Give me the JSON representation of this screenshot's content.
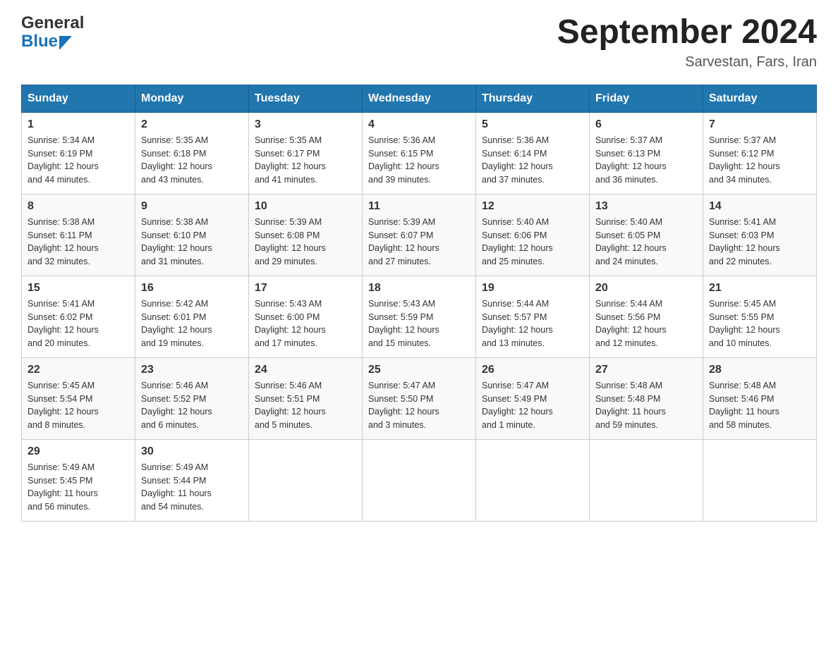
{
  "header": {
    "logo_general": "General",
    "logo_blue": "Blue",
    "month_title": "September 2024",
    "location": "Sarvestan, Fars, Iran"
  },
  "days_of_week": [
    "Sunday",
    "Monday",
    "Tuesday",
    "Wednesday",
    "Thursday",
    "Friday",
    "Saturday"
  ],
  "weeks": [
    [
      {
        "date": "1",
        "sunrise": "5:34 AM",
        "sunset": "6:19 PM",
        "daylight": "12 hours and 44 minutes."
      },
      {
        "date": "2",
        "sunrise": "5:35 AM",
        "sunset": "6:18 PM",
        "daylight": "12 hours and 43 minutes."
      },
      {
        "date": "3",
        "sunrise": "5:35 AM",
        "sunset": "6:17 PM",
        "daylight": "12 hours and 41 minutes."
      },
      {
        "date": "4",
        "sunrise": "5:36 AM",
        "sunset": "6:15 PM",
        "daylight": "12 hours and 39 minutes."
      },
      {
        "date": "5",
        "sunrise": "5:36 AM",
        "sunset": "6:14 PM",
        "daylight": "12 hours and 37 minutes."
      },
      {
        "date": "6",
        "sunrise": "5:37 AM",
        "sunset": "6:13 PM",
        "daylight": "12 hours and 36 minutes."
      },
      {
        "date": "7",
        "sunrise": "5:37 AM",
        "sunset": "6:12 PM",
        "daylight": "12 hours and 34 minutes."
      }
    ],
    [
      {
        "date": "8",
        "sunrise": "5:38 AM",
        "sunset": "6:11 PM",
        "daylight": "12 hours and 32 minutes."
      },
      {
        "date": "9",
        "sunrise": "5:38 AM",
        "sunset": "6:10 PM",
        "daylight": "12 hours and 31 minutes."
      },
      {
        "date": "10",
        "sunrise": "5:39 AM",
        "sunset": "6:08 PM",
        "daylight": "12 hours and 29 minutes."
      },
      {
        "date": "11",
        "sunrise": "5:39 AM",
        "sunset": "6:07 PM",
        "daylight": "12 hours and 27 minutes."
      },
      {
        "date": "12",
        "sunrise": "5:40 AM",
        "sunset": "6:06 PM",
        "daylight": "12 hours and 25 minutes."
      },
      {
        "date": "13",
        "sunrise": "5:40 AM",
        "sunset": "6:05 PM",
        "daylight": "12 hours and 24 minutes."
      },
      {
        "date": "14",
        "sunrise": "5:41 AM",
        "sunset": "6:03 PM",
        "daylight": "12 hours and 22 minutes."
      }
    ],
    [
      {
        "date": "15",
        "sunrise": "5:41 AM",
        "sunset": "6:02 PM",
        "daylight": "12 hours and 20 minutes."
      },
      {
        "date": "16",
        "sunrise": "5:42 AM",
        "sunset": "6:01 PM",
        "daylight": "12 hours and 19 minutes."
      },
      {
        "date": "17",
        "sunrise": "5:43 AM",
        "sunset": "6:00 PM",
        "daylight": "12 hours and 17 minutes."
      },
      {
        "date": "18",
        "sunrise": "5:43 AM",
        "sunset": "5:59 PM",
        "daylight": "12 hours and 15 minutes."
      },
      {
        "date": "19",
        "sunrise": "5:44 AM",
        "sunset": "5:57 PM",
        "daylight": "12 hours and 13 minutes."
      },
      {
        "date": "20",
        "sunrise": "5:44 AM",
        "sunset": "5:56 PM",
        "daylight": "12 hours and 12 minutes."
      },
      {
        "date": "21",
        "sunrise": "5:45 AM",
        "sunset": "5:55 PM",
        "daylight": "12 hours and 10 minutes."
      }
    ],
    [
      {
        "date": "22",
        "sunrise": "5:45 AM",
        "sunset": "5:54 PM",
        "daylight": "12 hours and 8 minutes."
      },
      {
        "date": "23",
        "sunrise": "5:46 AM",
        "sunset": "5:52 PM",
        "daylight": "12 hours and 6 minutes."
      },
      {
        "date": "24",
        "sunrise": "5:46 AM",
        "sunset": "5:51 PM",
        "daylight": "12 hours and 5 minutes."
      },
      {
        "date": "25",
        "sunrise": "5:47 AM",
        "sunset": "5:50 PM",
        "daylight": "12 hours and 3 minutes."
      },
      {
        "date": "26",
        "sunrise": "5:47 AM",
        "sunset": "5:49 PM",
        "daylight": "12 hours and 1 minute."
      },
      {
        "date": "27",
        "sunrise": "5:48 AM",
        "sunset": "5:48 PM",
        "daylight": "11 hours and 59 minutes."
      },
      {
        "date": "28",
        "sunrise": "5:48 AM",
        "sunset": "5:46 PM",
        "daylight": "11 hours and 58 minutes."
      }
    ],
    [
      {
        "date": "29",
        "sunrise": "5:49 AM",
        "sunset": "5:45 PM",
        "daylight": "11 hours and 56 minutes."
      },
      {
        "date": "30",
        "sunrise": "5:49 AM",
        "sunset": "5:44 PM",
        "daylight": "11 hours and 54 minutes."
      },
      null,
      null,
      null,
      null,
      null
    ]
  ],
  "labels": {
    "sunrise": "Sunrise:",
    "sunset": "Sunset:",
    "daylight": "Daylight:"
  }
}
